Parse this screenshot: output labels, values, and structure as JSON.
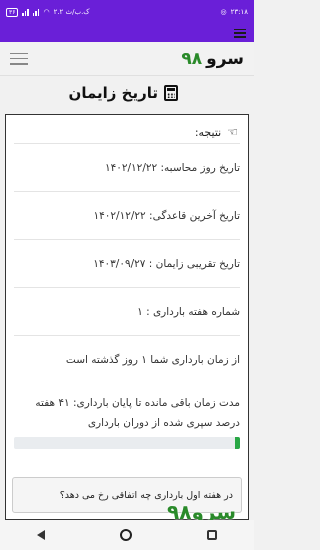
{
  "status_bar": {
    "time": "۲۳:۱۸",
    "battery": "۳۶",
    "network_speed": "۲.۲ ک.ب/ث"
  },
  "header": {
    "logo_word": "سرو",
    "logo_number": "۹۸"
  },
  "page": {
    "title": "تاریخ زایمان"
  },
  "result": {
    "heading": "نتیجه:",
    "rows": [
      "تاریخ روز محاسبه: ۱۴۰۲/۱۲/۲۲",
      "تاریخ آخرین قاعدگی: ۱۴۰۲/۱۲/۲۲",
      "تاریخ تقریبی زایمان : ۱۴۰۳/۰۹/۲۷",
      "شماره هفته بارداری : ۱",
      "از زمان بارداری شما ۱ روز گذشته است",
      "مدت زمان باقی مانده تا پایان بارداری: ۴۱ هفته"
    ],
    "progress_label": "درصد سپری شده از دوران بارداری",
    "progress_percent": 2,
    "faq_button": "در هفته اول بارداری چه اتفاقی رخ می دهد؟"
  },
  "watermark": "سرو۹۸",
  "colors": {
    "accent": "#6a1fd8",
    "brand_green": "#2a8a2a",
    "progress": "#28a745"
  }
}
